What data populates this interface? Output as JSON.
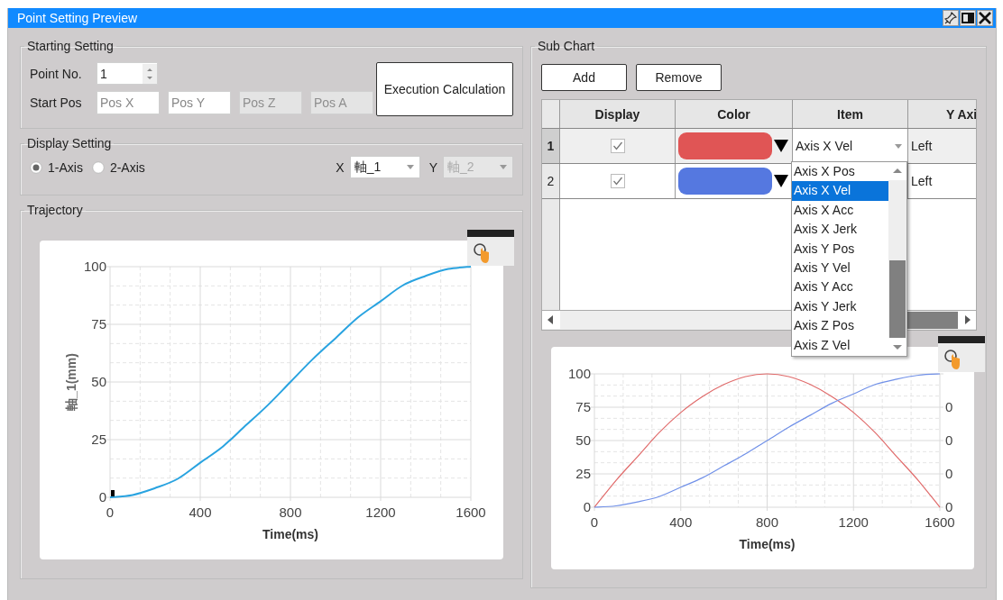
{
  "window": {
    "title": "Point Setting Preview"
  },
  "starting_setting": {
    "title": "Starting Setting",
    "point_no": {
      "label": "Point No.",
      "value": "1"
    },
    "start_pos": {
      "label": "Start Pos",
      "fields": [
        {
          "placeholder": "Pos X",
          "disabled": false
        },
        {
          "placeholder": "Pos Y",
          "disabled": false
        },
        {
          "placeholder": "Pos Z",
          "disabled": true
        },
        {
          "placeholder": "Pos A",
          "disabled": true
        }
      ]
    },
    "execute_button": "Execution Calculation"
  },
  "display_setting": {
    "title": "Display Setting",
    "modes": [
      {
        "label": "1-Axis",
        "selected": true
      },
      {
        "label": "2-Axis",
        "selected": false
      }
    ],
    "axes": [
      {
        "label": "X",
        "value": "軸_1",
        "disabled": false
      },
      {
        "label": "Y",
        "value": "軸_2",
        "disabled": true
      }
    ]
  },
  "trajectory": {
    "title": "Trajectory",
    "chart_data": {
      "type": "line",
      "grid": true,
      "xlabel": "Time(ms)",
      "ylabel": "軸_1(mm)",
      "xlim": [
        0,
        1600
      ],
      "ylim": [
        0,
        100
      ],
      "xticks": [
        0,
        400,
        800,
        1200,
        1600
      ],
      "yticks": [
        0,
        25,
        50,
        75,
        100
      ],
      "x": [
        0,
        100,
        200,
        300,
        400,
        500,
        600,
        700,
        800,
        900,
        1000,
        1100,
        1200,
        1300,
        1400,
        1500,
        1600
      ],
      "series": [
        {
          "color": "#29a3e0",
          "values": [
            0,
            1,
            4,
            8,
            15,
            22,
            31,
            40,
            50,
            60,
            69,
            78,
            85,
            92,
            96,
            99,
            100
          ]
        }
      ]
    }
  },
  "sub_chart": {
    "title": "Sub Chart",
    "buttons": [
      "Add",
      "Remove"
    ],
    "table": {
      "columns": [
        "Display",
        "Color",
        "Item",
        "Y Axi"
      ],
      "rows": [
        {
          "index": "1",
          "selected": true,
          "display": true,
          "color": "#e05555",
          "item": "Axis X Vel",
          "y_axis": "Left"
        },
        {
          "index": "2",
          "selected": false,
          "display": true,
          "color": "#5578e0",
          "y_axis": "Left"
        }
      ]
    },
    "dropdown": {
      "options": [
        {
          "label": "Axis X Pos",
          "selected": false
        },
        {
          "label": "Axis X Vel",
          "selected": true
        },
        {
          "label": "Axis X Acc",
          "selected": false
        },
        {
          "label": "Axis X Jerk",
          "selected": false
        },
        {
          "label": "Axis Y Pos",
          "selected": false
        },
        {
          "label": "Axis Y Vel",
          "selected": false
        },
        {
          "label": "Axis Y Acc",
          "selected": false
        },
        {
          "label": "Axis Y Jerk",
          "selected": false
        },
        {
          "label": "Axis Z Pos",
          "selected": false
        },
        {
          "label": "Axis Z Vel",
          "selected": false
        }
      ]
    },
    "right_axis_labels": [
      "0",
      "0",
      "0",
      "0"
    ],
    "chart_data": {
      "type": "line",
      "grid": true,
      "xlabel": "Time(ms)",
      "xlim": [
        0,
        1600
      ],
      "ylim": [
        0,
        100
      ],
      "xticks": [
        0,
        400,
        800,
        1200,
        1600
      ],
      "yticks": [
        0,
        25,
        50,
        75,
        100
      ],
      "x": [
        0,
        100,
        200,
        300,
        400,
        500,
        600,
        700,
        800,
        900,
        1000,
        1100,
        1200,
        1300,
        1400,
        1500,
        1600
      ],
      "series": [
        {
          "color": "#e06a6a",
          "values": [
            0,
            20,
            38,
            56,
            71,
            83,
            92,
            98,
            100,
            98,
            92,
            83,
            71,
            56,
            38,
            20,
            0
          ]
        },
        {
          "color": "#7090e8",
          "values": [
            0,
            1,
            4,
            8,
            15,
            22,
            31,
            40,
            50,
            60,
            69,
            78,
            85,
            92,
            96,
            99,
            100
          ]
        }
      ]
    }
  }
}
